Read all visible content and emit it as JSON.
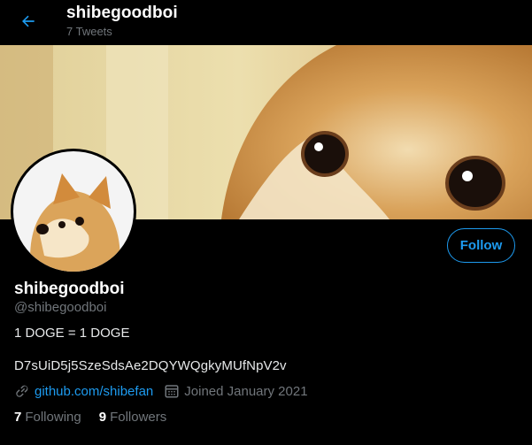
{
  "header": {
    "back_icon": "arrow-left-icon",
    "name": "shibegoodboi",
    "tweet_count": "7 Tweets"
  },
  "profile": {
    "display_name": "shibegoodboi",
    "handle": "@shibegoodboi",
    "bio": "1 DOGE = 1 DOGE",
    "address": "D7sUiD5j5SzeSdsAe2DQYWQgkyMUfNpV2v",
    "link_icon": "link-icon",
    "link": "github.com/shibefan",
    "calendar_icon": "calendar-icon",
    "joined": "Joined January 2021",
    "following_count": "7",
    "following_label": "Following",
    "followers_count": "9",
    "followers_label": "Followers"
  },
  "actions": {
    "follow_label": "Follow"
  },
  "colors": {
    "accent": "#1d9bf0",
    "background": "#000000",
    "muted": "#71767b"
  }
}
